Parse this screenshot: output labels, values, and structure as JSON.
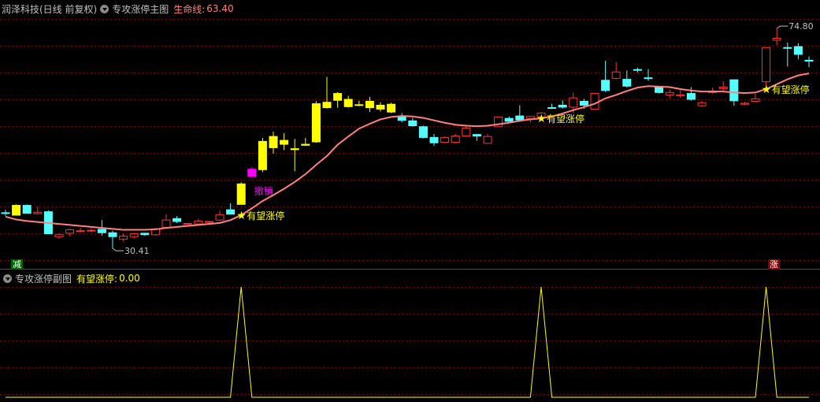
{
  "main_header": {
    "stock_name": "润泽科技(日线 前复权)",
    "indicator_name": "专攻涨停主图",
    "lifeline_label": "生命线:",
    "lifeline_value": "63.40"
  },
  "sub_header": {
    "indicator_name": "专攻涨停副图",
    "signal_label": "有望涨停:",
    "signal_value": "0.00"
  },
  "badges": {
    "left": "减",
    "right": "涨"
  },
  "colors": {
    "up": "#ff3232",
    "down": "#54ffff",
    "yellow": "#ffff00",
    "ma": "#ff8080",
    "grid": "#800000",
    "signal": "#ffff00",
    "magenta": "#ff00ff"
  },
  "chart_data": [
    {
      "type": "candlestick",
      "price_range": [
        28,
        78
      ],
      "candles": [
        {
          "o": 37.6,
          "h": 38.3,
          "l": 37.1,
          "c": 37.7,
          "color": "cyan"
        },
        {
          "o": 37.2,
          "h": 39.4,
          "l": 37.2,
          "c": 39.2,
          "color": "yellow"
        },
        {
          "o": 39.2,
          "h": 39.4,
          "l": 37.6,
          "c": 37.6,
          "color": "cyan"
        },
        {
          "o": 37.5,
          "h": 38.9,
          "l": 37.3,
          "c": 37.8,
          "color": "red"
        },
        {
          "o": 37.9,
          "h": 38.2,
          "l": 33.3,
          "c": 33.4,
          "color": "cyan"
        },
        {
          "o": 32.8,
          "h": 33.5,
          "l": 32.4,
          "c": 33.2,
          "color": "red"
        },
        {
          "o": 33.5,
          "h": 34.4,
          "l": 33.0,
          "c": 34.2,
          "color": "red"
        },
        {
          "o": 34.0,
          "h": 34.6,
          "l": 33.7,
          "c": 34.0,
          "color": "red"
        },
        {
          "o": 34.1,
          "h": 34.5,
          "l": 33.7,
          "c": 34.1,
          "color": "red"
        },
        {
          "o": 34.3,
          "h": 36.2,
          "l": 33.0,
          "c": 33.6,
          "color": "cyan"
        },
        {
          "o": 33.6,
          "h": 34.0,
          "l": 30.4,
          "c": 32.8,
          "color": "cyan"
        },
        {
          "o": 32.3,
          "h": 33.4,
          "l": 31.8,
          "c": 32.9,
          "color": "red"
        },
        {
          "o": 32.8,
          "h": 33.6,
          "l": 32.4,
          "c": 33.4,
          "color": "red"
        },
        {
          "o": 33.5,
          "h": 33.6,
          "l": 33.0,
          "c": 33.2,
          "color": "cyan"
        },
        {
          "o": 33.2,
          "h": 34.6,
          "l": 33.0,
          "c": 34.4,
          "color": "red"
        },
        {
          "o": 34.7,
          "h": 37.4,
          "l": 34.6,
          "c": 36.2,
          "color": "red"
        },
        {
          "o": 36.5,
          "h": 37.0,
          "l": 35.6,
          "c": 35.9,
          "color": "cyan"
        },
        {
          "o": 35.3,
          "h": 35.6,
          "l": 35.2,
          "c": 35.5,
          "color": "red"
        },
        {
          "o": 35.4,
          "h": 36.4,
          "l": 35.1,
          "c": 36.0,
          "color": "red"
        },
        {
          "o": 35.8,
          "h": 36.0,
          "l": 35.4,
          "c": 35.9,
          "color": "red"
        },
        {
          "o": 36.2,
          "h": 38.1,
          "l": 36.0,
          "c": 37.3,
          "color": "red"
        },
        {
          "o": 38.3,
          "h": 39.6,
          "l": 37.4,
          "c": 37.4,
          "color": "cyan"
        },
        {
          "o": 39.4,
          "h": 43.9,
          "l": 39.4,
          "c": 43.6,
          "color": "yellow"
        },
        {
          "o": 45.1,
          "h": 47.0,
          "l": 45.0,
          "c": 46.6,
          "color": "magenta"
        },
        {
          "o": 46.5,
          "h": 53.0,
          "l": 46.0,
          "c": 52.3,
          "color": "yellow"
        },
        {
          "o": 51.0,
          "h": 54.3,
          "l": 49.8,
          "c": 53.3,
          "color": "yellow"
        },
        {
          "o": 51.7,
          "h": 54.0,
          "l": 50.5,
          "c": 52.5,
          "color": "yellow"
        },
        {
          "o": 50.8,
          "h": 52.8,
          "l": 46.2,
          "c": 50.6,
          "color": "yellow"
        },
        {
          "o": 51.5,
          "h": 53.0,
          "l": 51.4,
          "c": 51.7,
          "color": "yellow"
        },
        {
          "o": 52.2,
          "h": 60.5,
          "l": 52.0,
          "c": 60.0,
          "color": "yellow"
        },
        {
          "o": 59.2,
          "h": 65.5,
          "l": 59.0,
          "c": 60.3,
          "color": "yellow"
        },
        {
          "o": 60.7,
          "h": 62.4,
          "l": 59.2,
          "c": 62.1,
          "color": "yellow"
        },
        {
          "o": 59.4,
          "h": 61.6,
          "l": 59.2,
          "c": 60.9,
          "color": "yellow"
        },
        {
          "o": 59.7,
          "h": 60.6,
          "l": 59.5,
          "c": 59.8,
          "color": "yellow"
        },
        {
          "o": 60.5,
          "h": 61.4,
          "l": 58.3,
          "c": 59.2,
          "color": "yellow"
        },
        {
          "o": 58.9,
          "h": 60.3,
          "l": 58.4,
          "c": 59.7,
          "color": "yellow"
        },
        {
          "o": 59.9,
          "h": 60.2,
          "l": 58.1,
          "c": 58.3,
          "color": "yellow"
        },
        {
          "o": 57.3,
          "h": 58.1,
          "l": 56.2,
          "c": 56.6,
          "color": "cyan"
        },
        {
          "o": 56.5,
          "h": 57.1,
          "l": 55.3,
          "c": 55.5,
          "color": "cyan"
        },
        {
          "o": 55.3,
          "h": 55.5,
          "l": 52.9,
          "c": 53.1,
          "color": "cyan"
        },
        {
          "o": 53.1,
          "h": 53.8,
          "l": 51.4,
          "c": 52.0,
          "color": "cyan"
        },
        {
          "o": 52.1,
          "h": 53.3,
          "l": 52.0,
          "c": 53.1,
          "color": "red"
        },
        {
          "o": 52.1,
          "h": 53.8,
          "l": 51.8,
          "c": 53.4,
          "color": "red"
        },
        {
          "o": 53.4,
          "h": 55.3,
          "l": 53.4,
          "c": 55.0,
          "color": "red"
        },
        {
          "o": 53.7,
          "h": 53.8,
          "l": 52.4,
          "c": 53.4,
          "color": "cyan"
        },
        {
          "o": 51.9,
          "h": 53.8,
          "l": 51.8,
          "c": 53.3,
          "color": "red"
        },
        {
          "o": 55.3,
          "h": 57.4,
          "l": 55.2,
          "c": 57.3,
          "color": "red"
        },
        {
          "o": 57.0,
          "h": 57.4,
          "l": 56.3,
          "c": 56.4,
          "color": "cyan"
        },
        {
          "o": 56.7,
          "h": 59.7,
          "l": 56.3,
          "c": 57.5,
          "color": "cyan"
        },
        {
          "o": 57.0,
          "h": 57.5,
          "l": 56.2,
          "c": 57.4,
          "color": "red"
        },
        {
          "o": 57.3,
          "h": 58.3,
          "l": 57.0,
          "c": 58.1,
          "color": "red"
        },
        {
          "o": 59.2,
          "h": 60.0,
          "l": 59.0,
          "c": 59.2,
          "color": "cyan"
        },
        {
          "o": 59.7,
          "h": 60.7,
          "l": 59.0,
          "c": 59.3,
          "color": "cyan"
        },
        {
          "o": 59.3,
          "h": 62.3,
          "l": 58.1,
          "c": 61.2,
          "color": "red"
        },
        {
          "o": 60.5,
          "h": 61.0,
          "l": 59.0,
          "c": 59.7,
          "color": "cyan"
        },
        {
          "o": 58.9,
          "h": 61.9,
          "l": 58.7,
          "c": 62.1,
          "color": "red"
        },
        {
          "o": 64.8,
          "h": 68.8,
          "l": 62.4,
          "c": 62.7,
          "color": "cyan"
        },
        {
          "o": 65.2,
          "h": 68.5,
          "l": 65.0,
          "c": 66.5,
          "color": "red"
        },
        {
          "o": 65.0,
          "h": 66.8,
          "l": 63.3,
          "c": 63.6,
          "color": "cyan"
        },
        {
          "o": 67.0,
          "h": 67.4,
          "l": 66.4,
          "c": 67.0,
          "color": "cyan"
        },
        {
          "o": 65.3,
          "h": 67.1,
          "l": 64.7,
          "c": 65.3,
          "color": "cyan"
        },
        {
          "o": 63.4,
          "h": 63.6,
          "l": 62.1,
          "c": 62.3,
          "color": "cyan"
        },
        {
          "o": 62.3,
          "h": 62.9,
          "l": 61.1,
          "c": 61.8,
          "color": "red"
        },
        {
          "o": 61.6,
          "h": 62.8,
          "l": 61.2,
          "c": 61.8,
          "color": "red"
        },
        {
          "o": 62.1,
          "h": 63.4,
          "l": 60.6,
          "c": 60.9,
          "color": "cyan"
        },
        {
          "o": 60.2,
          "h": 60.6,
          "l": 59.3,
          "c": 59.6,
          "color": "red"
        },
        {
          "o": 62.3,
          "h": 63.3,
          "l": 62.1,
          "c": 62.6,
          "color": "red"
        },
        {
          "o": 63.4,
          "h": 64.6,
          "l": 62.4,
          "c": 63.1,
          "color": "red"
        },
        {
          "o": 64.9,
          "h": 65.0,
          "l": 59.6,
          "c": 60.6,
          "color": "cyan"
        },
        {
          "o": 59.9,
          "h": 60.4,
          "l": 59.7,
          "c": 60.1,
          "color": "red"
        },
        {
          "o": 60.5,
          "h": 62.0,
          "l": 60.3,
          "c": 61.0,
          "color": "red"
        },
        {
          "o": 64.5,
          "h": 71.6,
          "l": 63.6,
          "c": 71.5,
          "color": "red"
        },
        {
          "o": 73.0,
          "h": 75.4,
          "l": 72.0,
          "c": 73.4,
          "color": "red"
        },
        {
          "o": 71.5,
          "h": 72.5,
          "l": 67.6,
          "c": 71.5,
          "color": "cyan"
        },
        {
          "o": 71.7,
          "h": 72.4,
          "l": 69.1,
          "c": 70.1,
          "color": "cyan"
        },
        {
          "o": 68.9,
          "h": 69.7,
          "l": 67.5,
          "c": 68.7,
          "color": "cyan"
        }
      ],
      "ma_label": "生命线",
      "ma": [
        36.9,
        36.3,
        36.0,
        35.8,
        35.6,
        35.4,
        35.2,
        35.0,
        34.8,
        34.6,
        34.4,
        34.2,
        34.2,
        34.2,
        34.3,
        34.6,
        34.8,
        35.0,
        35.2,
        35.4,
        35.6,
        36.2,
        37.2,
        38.6,
        40.1,
        41.3,
        42.6,
        44.0,
        45.6,
        47.5,
        49.3,
        51.6,
        53.3,
        54.9,
        55.9,
        56.8,
        57.3,
        57.5,
        57.4,
        57.1,
        56.6,
        56.1,
        55.7,
        55.5,
        55.4,
        55.5,
        55.8,
        56.1,
        56.5,
        56.8,
        57.0,
        57.4,
        58.0,
        58.7,
        59.3,
        60.0,
        61.1,
        61.8,
        62.6,
        63.3,
        63.6,
        63.5,
        63.4,
        63.0,
        62.7,
        62.5,
        62.5,
        62.5,
        62.3,
        62.2,
        62.3,
        63.0,
        64.0,
        65.0,
        65.8,
        66.2
      ],
      "annotations": [
        {
          "i": 22,
          "text": "有望涨停"
        },
        {
          "i": 50,
          "text": "有望涨停"
        },
        {
          "i": 71,
          "text": "有望涨停"
        }
      ],
      "cancel_label": {
        "i": 23,
        "text": "撤销"
      },
      "max_label": "74.80",
      "min_label": "30.41",
      "ticks": []
    },
    {
      "type": "line",
      "title": "有望涨停",
      "values_peak_at": [
        22,
        50,
        71
      ],
      "range": [
        0,
        1
      ]
    }
  ]
}
